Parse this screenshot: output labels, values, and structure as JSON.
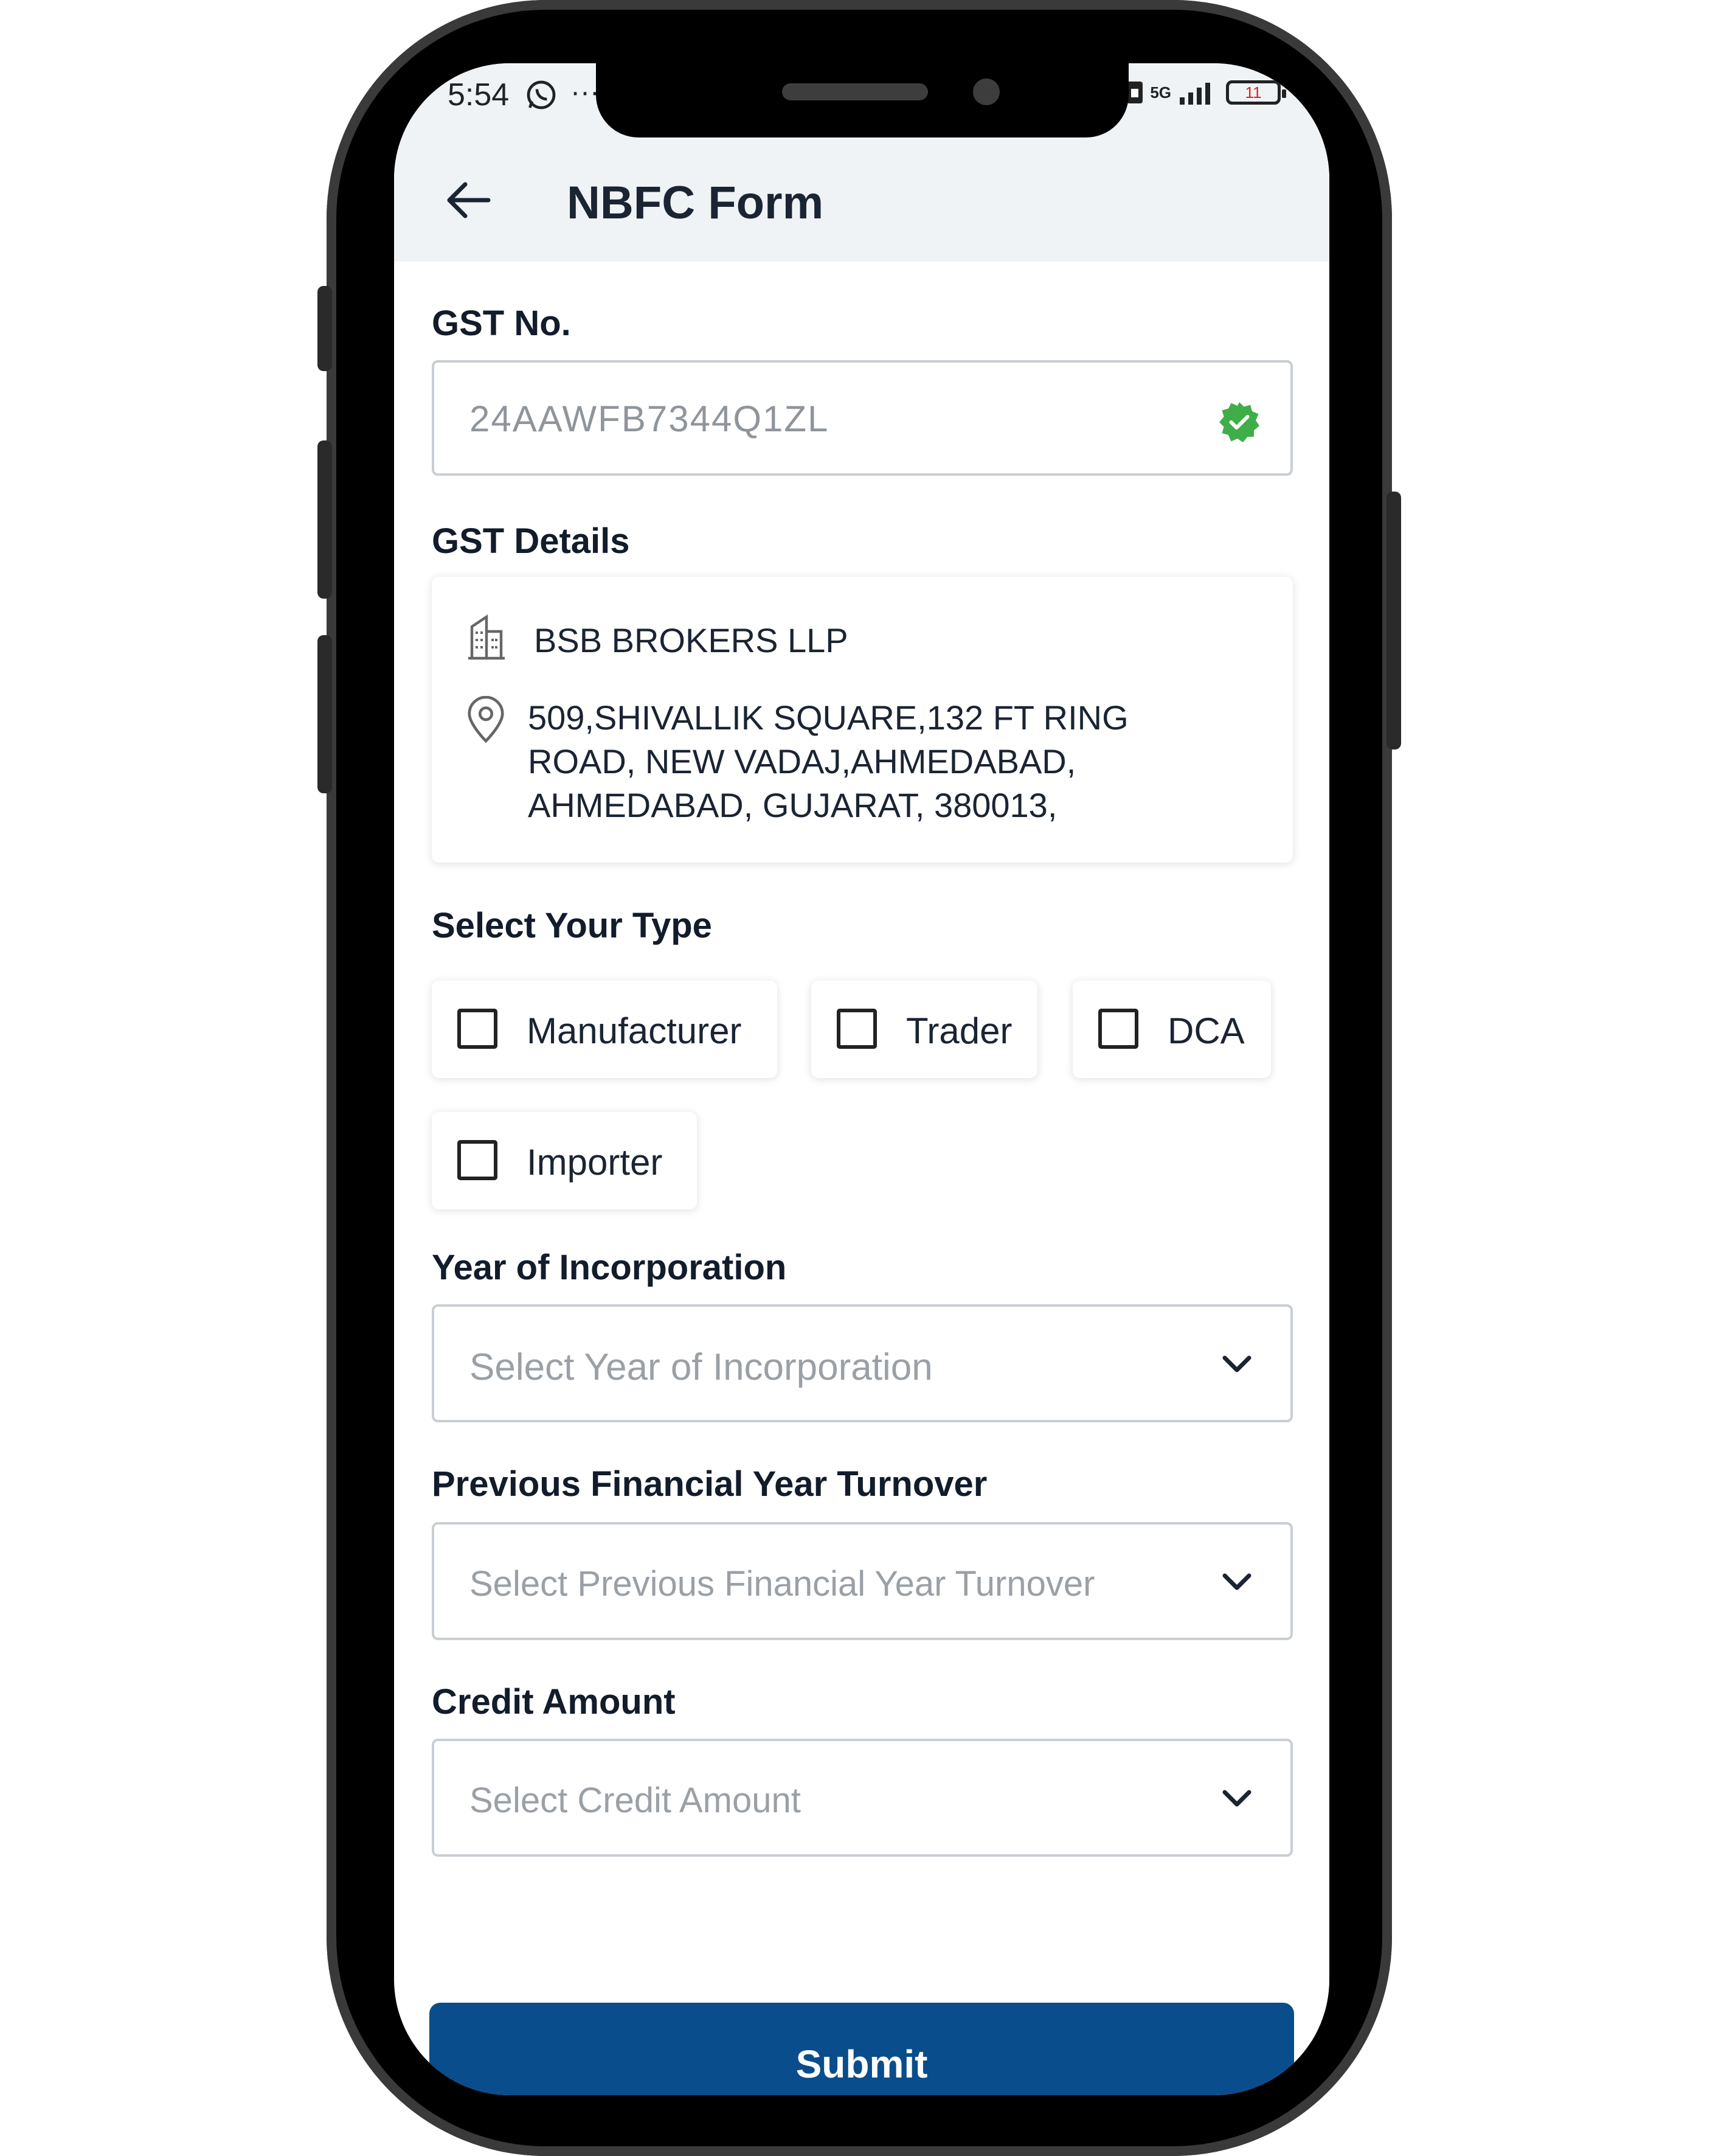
{
  "status_bar": {
    "time": "5:54",
    "dots": "···",
    "network": "5G",
    "battery": "11"
  },
  "header": {
    "title": "NBFC Form"
  },
  "gst_no": {
    "label": "GST No.",
    "value": "24AAWFB7344Q1ZL",
    "verified_color": "#3fae49"
  },
  "gst_details": {
    "label": "GST Details",
    "company_name": "BSB BROKERS LLP",
    "address_lines": [
      "509,SHIVALLIK SQUARE,132 FT RING",
      "ROAD, NEW VADAJ,AHMEDABAD,",
      "AHMEDABAD, GUJARAT, 380013,"
    ]
  },
  "select_type": {
    "label": "Select Your Type",
    "options": [
      {
        "label": "Manufacturer",
        "checked": false
      },
      {
        "label": "Trader",
        "checked": false
      },
      {
        "label": "DCA",
        "checked": false
      },
      {
        "label": "Importer",
        "checked": false
      }
    ]
  },
  "year_of_incorporation": {
    "label": "Year of Incorporation",
    "placeholder": "Select Year of Incorporation"
  },
  "turnover": {
    "label": "Previous Financial Year Turnover",
    "placeholder": "Select Previous Financial Year Turnover"
  },
  "credit_amount": {
    "label": "Credit Amount",
    "placeholder": "Select Credit Amount"
  },
  "submit": {
    "label": "Submit",
    "color": "#0a4d8c"
  }
}
